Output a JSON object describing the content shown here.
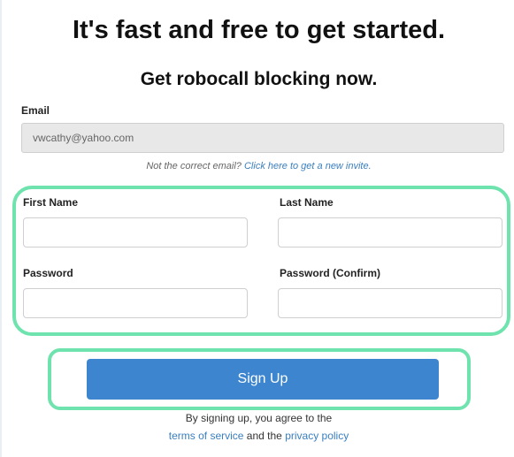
{
  "header": {
    "title": "It's fast and free to get started.",
    "subtitle": "Get robocall blocking now."
  },
  "email": {
    "label": "Email",
    "value": "vwcathy@yahoo.com",
    "note_prefix": "Not the correct email?",
    "note_link": "Click here to get a new invite."
  },
  "form": {
    "first_name_label": "First Name",
    "last_name_label": "Last Name",
    "password_label": "Password",
    "password_confirm_label": "Password (Confirm)",
    "first_name_value": "",
    "last_name_value": "",
    "password_value": "",
    "password_confirm_value": ""
  },
  "signup": {
    "button_label": "Sign Up",
    "agree_text": "By signing up, you agree to the",
    "terms_link": "terms of service",
    "and_text": "and the",
    "privacy_link": "privacy policy"
  },
  "colors": {
    "highlight": "#6fe3ad",
    "button": "#3d86cf",
    "link": "#3a7fc0"
  }
}
